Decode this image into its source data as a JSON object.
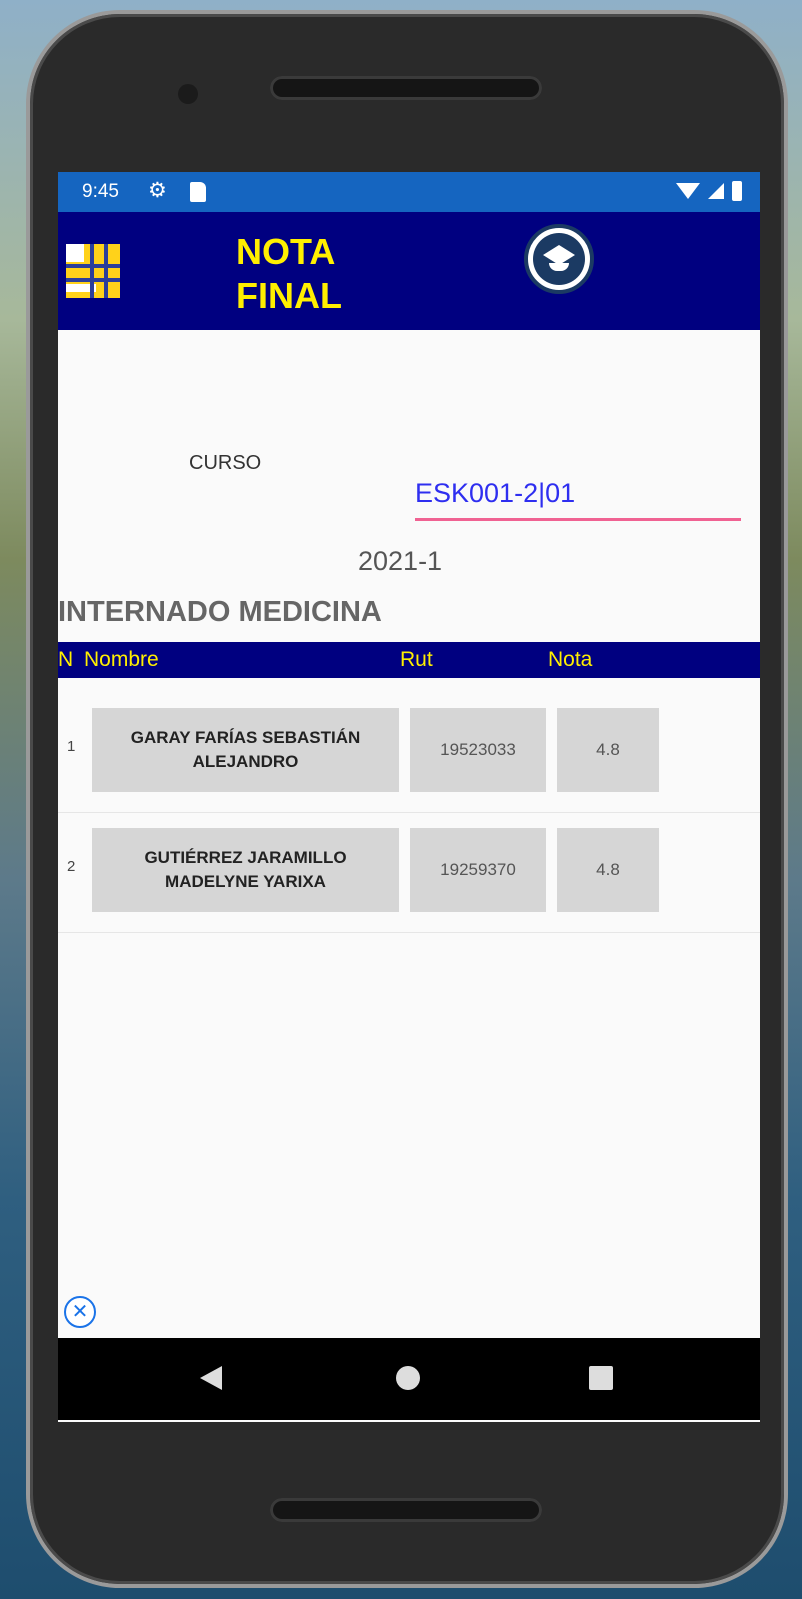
{
  "status_bar": {
    "time": "9:45"
  },
  "app_bar": {
    "title_line1": "NOTA",
    "title_line2": "FINAL"
  },
  "form": {
    "curso_label": "CURSO",
    "curso_value": "ESK001-2|01"
  },
  "period": "2021-1",
  "program": "INTERNADO MEDICINA",
  "table": {
    "headers": {
      "n": "N",
      "nombre": "Nombre",
      "rut": "Rut",
      "nota": "Nota"
    },
    "rows": [
      {
        "n": "1",
        "name_line1": "GARAY FARÍAS SEBASTIÁN",
        "name_line2": "ALEJANDRO",
        "rut": "19523033",
        "nota": "4.8"
      },
      {
        "n": "2",
        "name_line1": "GUTIÉRREZ JARAMILLO",
        "name_line2": "MADELYNE YARIXA",
        "rut": "19259370",
        "nota": "4.8"
      }
    ]
  },
  "colors": {
    "header_bg": "#000080",
    "header_text": "#ffef00",
    "status_bar": "#1565c0",
    "input_underline": "#f06292",
    "input_text": "#2e2ef0"
  },
  "icons": [
    "settings-gear-icon",
    "sd-card-icon",
    "wifi-icon",
    "signal-icon",
    "battery-icon",
    "app-logo-icon",
    "graduation-cap-icon",
    "close-ad-icon",
    "nav-back-icon",
    "nav-home-icon",
    "nav-recents-icon"
  ]
}
